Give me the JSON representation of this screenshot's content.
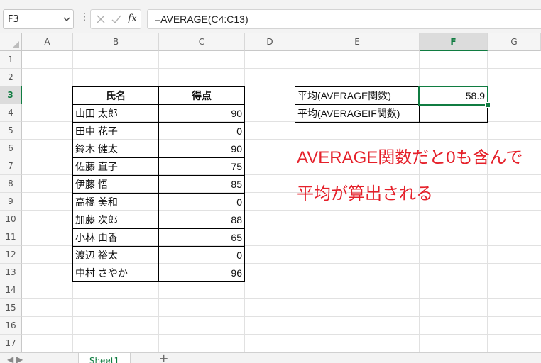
{
  "formula_bar": {
    "name_box": "F3",
    "formula": "=AVERAGE(C4:C13)",
    "fx_label": "fx",
    "icons": [
      "chevron-down-icon",
      "more-icon",
      "cancel-icon",
      "confirm-icon",
      "function-icon"
    ]
  },
  "columns": [
    "A",
    "B",
    "C",
    "D",
    "E",
    "F",
    "G"
  ],
  "rows": [
    "1",
    "2",
    "3",
    "4",
    "5",
    "6",
    "7",
    "8",
    "9",
    "10",
    "11",
    "12",
    "13",
    "14",
    "15",
    "16",
    "17"
  ],
  "selected": {
    "column": "F",
    "row": "3"
  },
  "table": {
    "headers": [
      "氏名",
      "得点"
    ],
    "rows": [
      [
        "山田 太郎",
        "90"
      ],
      [
        "田中 花子",
        "0"
      ],
      [
        "鈴木 健太",
        "90"
      ],
      [
        "佐藤 直子",
        "75"
      ],
      [
        "伊藤 悟",
        "85"
      ],
      [
        "高橋 美和",
        "0"
      ],
      [
        "加藤 次郎",
        "88"
      ],
      [
        "小林 由香",
        "65"
      ],
      [
        "渡辺 裕太",
        "0"
      ],
      [
        "中村 さやか",
        "96"
      ]
    ]
  },
  "summary": [
    {
      "label": "平均(AVERAGE関数)",
      "value": "58.9"
    },
    {
      "label": "平均(AVERAGEIF関数)",
      "value": ""
    }
  ],
  "annotation": [
    "AVERAGE関数だと0も含んで",
    "平均が算出される"
  ],
  "sheet_tab": "Sheet1",
  "colors": {
    "accent": "#107c41",
    "annotation": "#e5202a"
  }
}
